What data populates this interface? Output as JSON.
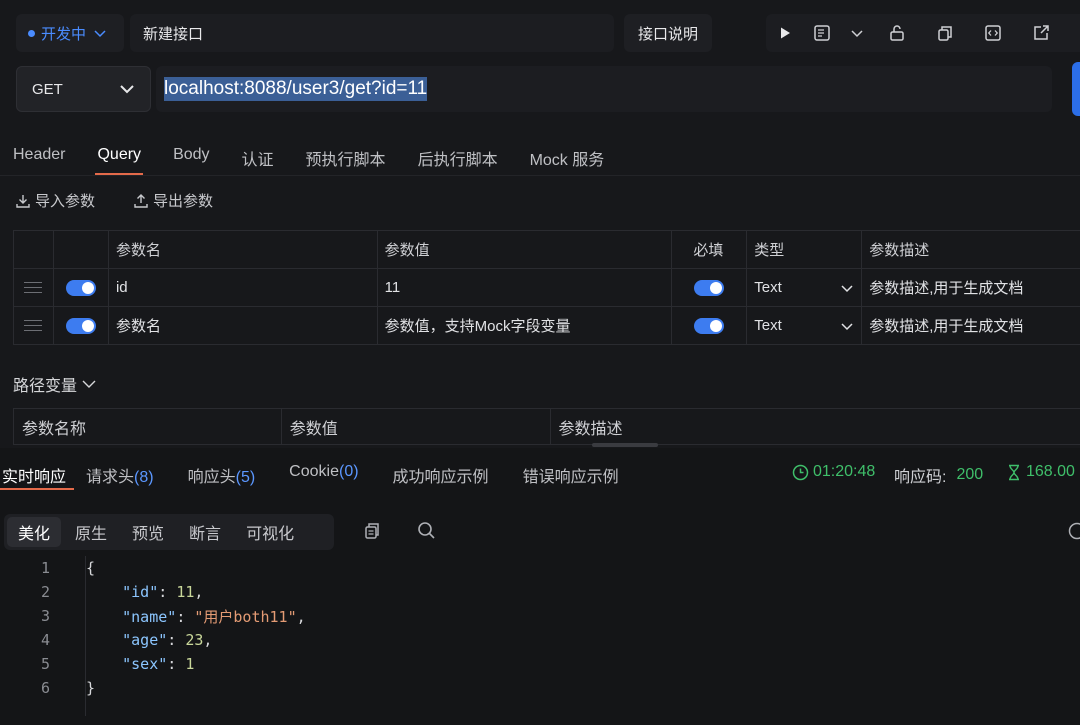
{
  "header": {
    "env_label": "开发中",
    "request_name": "新建接口",
    "doc_button": "接口说明"
  },
  "colors": {
    "accent_blue": "#2c6ee8",
    "tab_underline": "#e46a4a",
    "status_green": "#3fbf6a"
  },
  "request": {
    "method": "GET",
    "url": "localhost:8088/user3/get?id=11"
  },
  "tabs": [
    "Header",
    "Query",
    "Body",
    "认证",
    "预执行脚本",
    "后执行脚本",
    "Mock 服务"
  ],
  "active_tab": "Query",
  "actions": {
    "import": "导入参数",
    "export": "导出参数"
  },
  "params_table": {
    "headers": [
      "参数名",
      "参数值",
      "必填",
      "类型",
      "参数描述"
    ],
    "rows": [
      {
        "name": "id",
        "value": "11",
        "type": "Text",
        "desc_placeholder": "参数描述,用于生成文档"
      },
      {
        "name_placeholder": "参数名",
        "value_placeholder": "参数值，支持Mock字段变量",
        "type": "Text",
        "desc_placeholder": "参数描述,用于生成文档"
      }
    ]
  },
  "path_vars": {
    "label": "路径变量",
    "headers": [
      "参数名称",
      "参数值",
      "参数描述"
    ]
  },
  "response": {
    "tabs": [
      {
        "label": "实时响应"
      },
      {
        "label": "请求头",
        "count": "8"
      },
      {
        "label": "响应头",
        "count": "5"
      },
      {
        "label": "Cookie",
        "count": "0"
      },
      {
        "label": "成功响应示例"
      },
      {
        "label": "错误响应示例"
      }
    ],
    "time": "01:20:48",
    "status_label": "响应码:",
    "status_code": "200",
    "duration": "168.00",
    "view_modes": [
      "美化",
      "原生",
      "预览",
      "断言",
      "可视化"
    ],
    "code_lines": [
      {
        "n": "1",
        "text": "{"
      },
      {
        "n": "2",
        "key": "\"id\"",
        "val": "11",
        "vtype": "n",
        "comma": ","
      },
      {
        "n": "3",
        "key": "\"name\"",
        "val": "\"用户both11\"",
        "vtype": "s",
        "comma": ","
      },
      {
        "n": "4",
        "key": "\"age\"",
        "val": "23",
        "vtype": "n",
        "comma": ","
      },
      {
        "n": "5",
        "key": "\"sex\"",
        "val": "1",
        "vtype": "n",
        "comma": ""
      },
      {
        "n": "6",
        "text": "}"
      }
    ]
  }
}
